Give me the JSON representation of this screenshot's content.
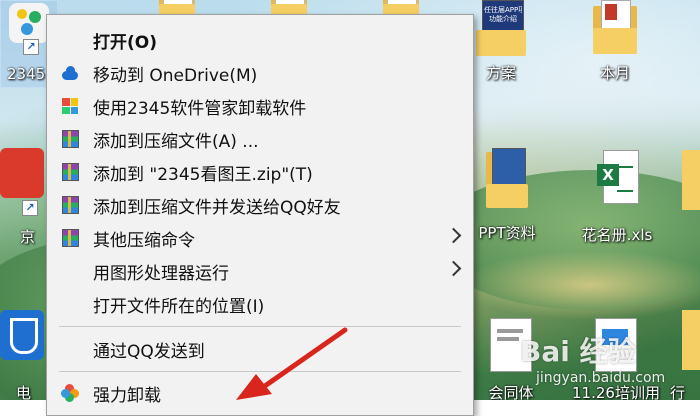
{
  "desktop": {
    "icons": [
      {
        "label": "2345"
      },
      {
        "label": "方案"
      },
      {
        "label": "本月"
      },
      {
        "label": "京"
      },
      {
        "label": "PPT资料"
      },
      {
        "label": "花名册.xls"
      },
      {
        "label": "电"
      },
      {
        "label": "会同体"
      },
      {
        "label": "11.26培训用"
      },
      {
        "label": "行"
      }
    ],
    "folder_cover_text": "任往届APP项\n功能介绍",
    "excel_badge": "X"
  },
  "context_menu": {
    "items": [
      {
        "label": "打开(O)",
        "icon": "none",
        "bold": true
      },
      {
        "label": "移动到 OneDrive(M)",
        "icon": "onedrive-cloud-icon"
      },
      {
        "label": "使用2345软件管家卸载软件",
        "icon": "software-manager-icon"
      },
      {
        "label": "添加到压缩文件(A) ...",
        "icon": "winrar-icon"
      },
      {
        "label": "添加到 \"2345看图王.zip\"(T)",
        "icon": "winrar-icon"
      },
      {
        "label": "添加到压缩文件并发送给QQ好友",
        "icon": "winrar-icon"
      },
      {
        "label": "其他压缩命令",
        "icon": "winrar-icon",
        "submenu": true
      },
      {
        "label": "用图形处理器运行",
        "icon": "none",
        "submenu": true
      },
      {
        "label": "打开文件所在的位置(I)",
        "icon": "none"
      },
      {
        "label": "通过QQ发送到",
        "icon": "none"
      },
      {
        "label": "强力卸载",
        "icon": "uninstall-flower-icon"
      }
    ]
  },
  "watermark": {
    "main": "Bai 经验",
    "sub": "jingyan.baidu.com"
  },
  "colors": {
    "menu_bg": "#f2f2f2",
    "annotation_arrow": "#d9251d",
    "excel_green": "#1d7a43",
    "folder_yellow": "#f5cf63"
  }
}
